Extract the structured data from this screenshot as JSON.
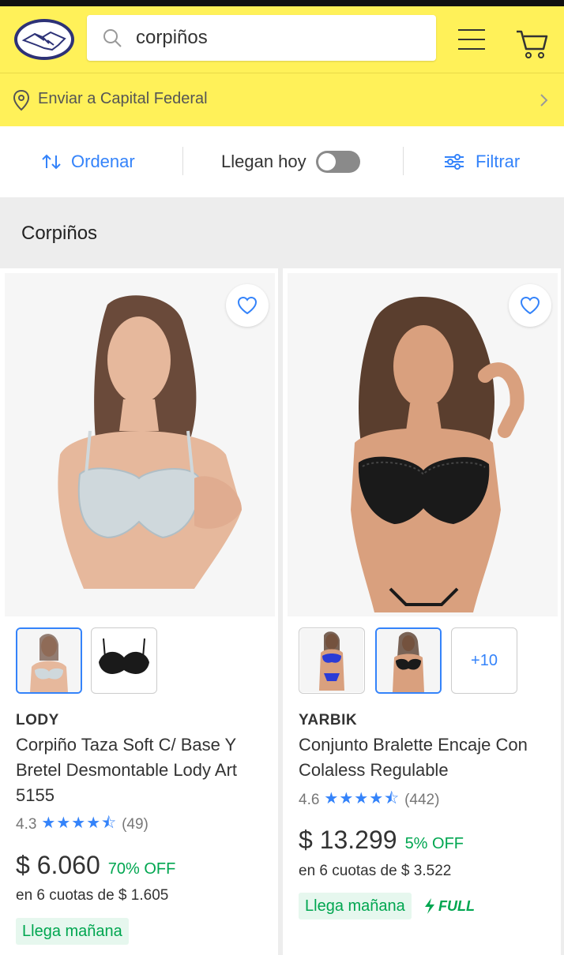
{
  "header": {
    "search_query": "corpiños"
  },
  "location": {
    "label": "Enviar a Capital Federal"
  },
  "filters": {
    "sort_label": "Ordenar",
    "today_label": "Llegan hoy",
    "filter_label": "Filtrar"
  },
  "section": {
    "title": "Corpiños"
  },
  "products": [
    {
      "brand": "LODY",
      "title": "Corpiño Taza Soft C/ Base Y Bretel Desmontable Lody Art 5155",
      "rating": "4.3",
      "reviews": "(49)",
      "stars": "★★★★⯪",
      "price": "$ 6.060",
      "discount": "70% OFF",
      "installments": "en 6 cuotas de $ 1.605",
      "delivery": "Llega mañana"
    },
    {
      "brand": "YARBIK",
      "title": "Conjunto Bralette Encaje Con Colaless Regulable",
      "rating": "4.6",
      "reviews": "(442)",
      "stars": "★★★★⯪",
      "price": "$ 13.299",
      "discount": "5% OFF",
      "installments": "en 6 cuotas de $ 3.522",
      "delivery": "Llega mañana",
      "full_badge": "FULL",
      "more_thumbs": "+10"
    }
  ],
  "colors": {
    "header_yellow": "#fff159",
    "accent_blue": "#3483fa",
    "green": "#00a650"
  }
}
